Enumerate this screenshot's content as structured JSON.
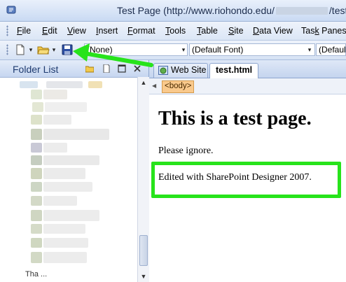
{
  "window": {
    "title_prefix": "Test Page (http://www.riohondo.edu/",
    "title_suffix": "/test."
  },
  "menu": {
    "items": [
      {
        "accel": "F",
        "rest": "ile"
      },
      {
        "accel": "E",
        "rest": "dit"
      },
      {
        "accel": "V",
        "rest": "iew"
      },
      {
        "accel": "I",
        "rest": "nsert"
      },
      {
        "accel": "F",
        "rest": "ormat",
        "pre": ""
      },
      {
        "accel": "T",
        "rest": "ools"
      },
      {
        "accel": "T",
        "rest": "able"
      },
      {
        "accel": "S",
        "rest": "ite"
      },
      {
        "accel": "D",
        "rest": "ata View"
      },
      {
        "pre": "Tas",
        "accel": "k",
        "rest": " Panes"
      }
    ]
  },
  "toolbar": {
    "style_value": "(None)",
    "font_value": "(Default Font)",
    "size_value": "(Default"
  },
  "folder_list": {
    "title": "Folder List",
    "bottom_item": "Tha   ..."
  },
  "editor": {
    "tabs": [
      "Web Site",
      "test.html"
    ],
    "tag": "<body>",
    "heading": "This is a test page.",
    "para1": "Please ignore.",
    "para2": "Edited with SharePoint Designer 2007."
  },
  "colors": {
    "highlight": "#27e31b",
    "arrow": "#27e31b",
    "tag_bg": "#f9c98c"
  }
}
